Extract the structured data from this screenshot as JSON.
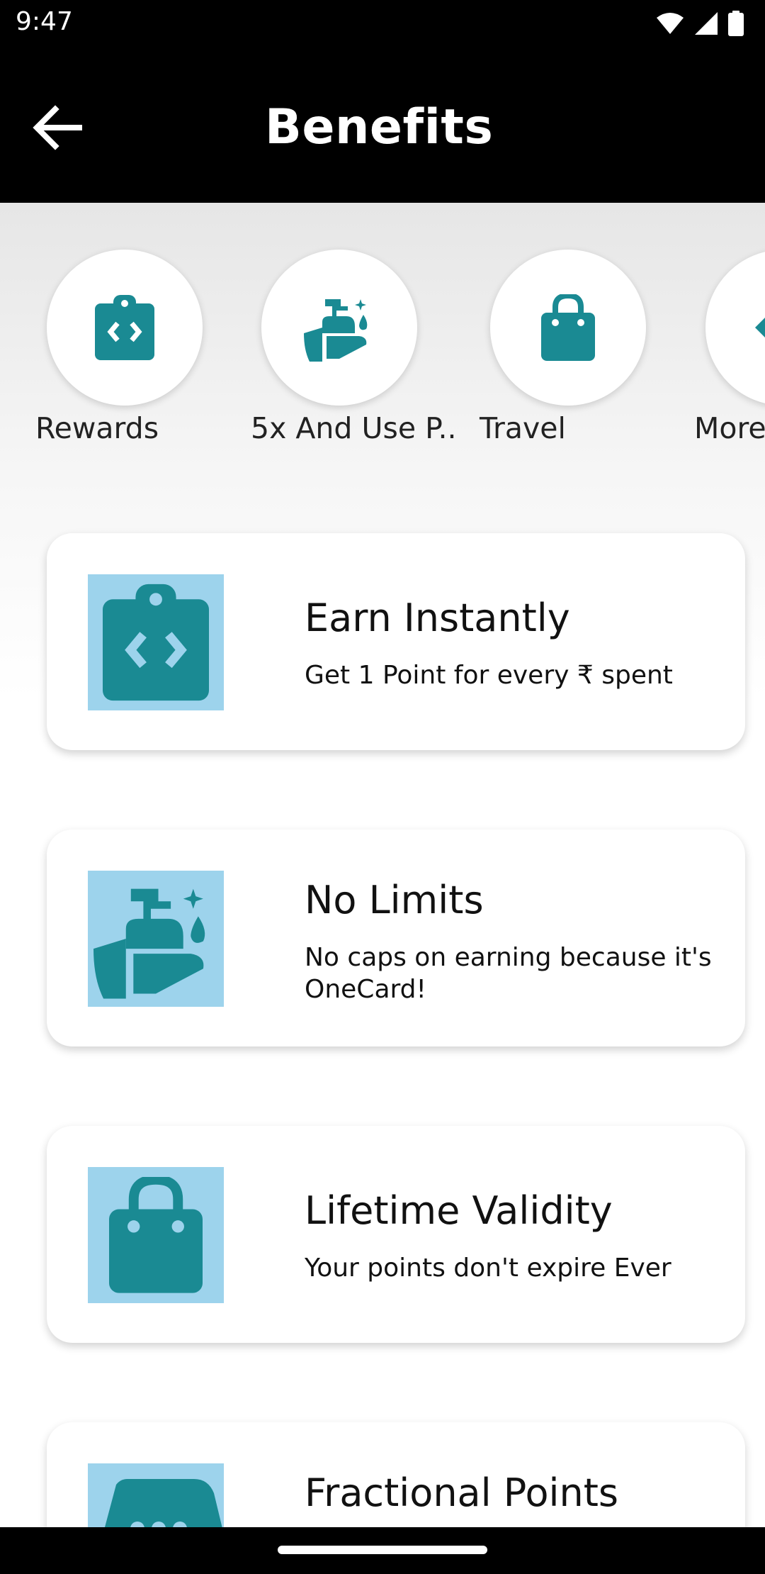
{
  "status_bar": {
    "time": "9:47"
  },
  "header": {
    "title": "Benefits"
  },
  "categories": [
    {
      "label": "Rewards",
      "icon": "clipboard-code-icon"
    },
    {
      "label": "5x And Use P..",
      "icon": "hand-wash-icon"
    },
    {
      "label": "Travel",
      "icon": "shopping-bag-icon"
    },
    {
      "label": "More",
      "icon": "diamond-icon"
    }
  ],
  "cards": [
    {
      "title": "Earn Instantly",
      "subtitle": "Get 1 Point for every ₹ spent",
      "icon": "clipboard-code-icon"
    },
    {
      "title": "No Limits",
      "subtitle": "No caps on earning because it's OneCard!",
      "icon": "hand-wash-icon"
    },
    {
      "title": "Lifetime Validity",
      "subtitle": "Your points don't expire Ever",
      "icon": "shopping-bag-icon"
    },
    {
      "title": "Fractional Points",
      "subtitle": "",
      "icon": "tag-icon"
    }
  ],
  "colors": {
    "icon_teal": "#1a8a93",
    "icon_bg": "#9dd3ec",
    "header_bg": "#000000"
  }
}
